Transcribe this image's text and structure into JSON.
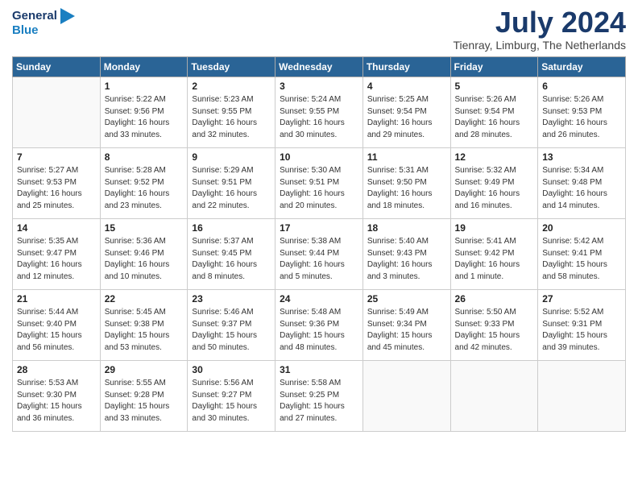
{
  "header": {
    "logo_line1": "General",
    "logo_line2": "Blue",
    "month_title": "July 2024",
    "location": "Tienray, Limburg, The Netherlands"
  },
  "days_of_week": [
    "Sunday",
    "Monday",
    "Tuesday",
    "Wednesday",
    "Thursday",
    "Friday",
    "Saturday"
  ],
  "weeks": [
    [
      {
        "day": "",
        "empty": true
      },
      {
        "day": "1",
        "sunrise": "5:22 AM",
        "sunset": "9:56 PM",
        "daylight": "16 hours and 33 minutes."
      },
      {
        "day": "2",
        "sunrise": "5:23 AM",
        "sunset": "9:55 PM",
        "daylight": "16 hours and 32 minutes."
      },
      {
        "day": "3",
        "sunrise": "5:24 AM",
        "sunset": "9:55 PM",
        "daylight": "16 hours and 30 minutes."
      },
      {
        "day": "4",
        "sunrise": "5:25 AM",
        "sunset": "9:54 PM",
        "daylight": "16 hours and 29 minutes."
      },
      {
        "day": "5",
        "sunrise": "5:26 AM",
        "sunset": "9:54 PM",
        "daylight": "16 hours and 28 minutes."
      },
      {
        "day": "6",
        "sunrise": "5:26 AM",
        "sunset": "9:53 PM",
        "daylight": "16 hours and 26 minutes."
      }
    ],
    [
      {
        "day": "7",
        "sunrise": "5:27 AM",
        "sunset": "9:53 PM",
        "daylight": "16 hours and 25 minutes."
      },
      {
        "day": "8",
        "sunrise": "5:28 AM",
        "sunset": "9:52 PM",
        "daylight": "16 hours and 23 minutes."
      },
      {
        "day": "9",
        "sunrise": "5:29 AM",
        "sunset": "9:51 PM",
        "daylight": "16 hours and 22 minutes."
      },
      {
        "day": "10",
        "sunrise": "5:30 AM",
        "sunset": "9:51 PM",
        "daylight": "16 hours and 20 minutes."
      },
      {
        "day": "11",
        "sunrise": "5:31 AM",
        "sunset": "9:50 PM",
        "daylight": "16 hours and 18 minutes."
      },
      {
        "day": "12",
        "sunrise": "5:32 AM",
        "sunset": "9:49 PM",
        "daylight": "16 hours and 16 minutes."
      },
      {
        "day": "13",
        "sunrise": "5:34 AM",
        "sunset": "9:48 PM",
        "daylight": "16 hours and 14 minutes."
      }
    ],
    [
      {
        "day": "14",
        "sunrise": "5:35 AM",
        "sunset": "9:47 PM",
        "daylight": "16 hours and 12 minutes."
      },
      {
        "day": "15",
        "sunrise": "5:36 AM",
        "sunset": "9:46 PM",
        "daylight": "16 hours and 10 minutes."
      },
      {
        "day": "16",
        "sunrise": "5:37 AM",
        "sunset": "9:45 PM",
        "daylight": "16 hours and 8 minutes."
      },
      {
        "day": "17",
        "sunrise": "5:38 AM",
        "sunset": "9:44 PM",
        "daylight": "16 hours and 5 minutes."
      },
      {
        "day": "18",
        "sunrise": "5:40 AM",
        "sunset": "9:43 PM",
        "daylight": "16 hours and 3 minutes."
      },
      {
        "day": "19",
        "sunrise": "5:41 AM",
        "sunset": "9:42 PM",
        "daylight": "16 hours and 1 minute."
      },
      {
        "day": "20",
        "sunrise": "5:42 AM",
        "sunset": "9:41 PM",
        "daylight": "15 hours and 58 minutes."
      }
    ],
    [
      {
        "day": "21",
        "sunrise": "5:44 AM",
        "sunset": "9:40 PM",
        "daylight": "15 hours and 56 minutes."
      },
      {
        "day": "22",
        "sunrise": "5:45 AM",
        "sunset": "9:38 PM",
        "daylight": "15 hours and 53 minutes."
      },
      {
        "day": "23",
        "sunrise": "5:46 AM",
        "sunset": "9:37 PM",
        "daylight": "15 hours and 50 minutes."
      },
      {
        "day": "24",
        "sunrise": "5:48 AM",
        "sunset": "9:36 PM",
        "daylight": "15 hours and 48 minutes."
      },
      {
        "day": "25",
        "sunrise": "5:49 AM",
        "sunset": "9:34 PM",
        "daylight": "15 hours and 45 minutes."
      },
      {
        "day": "26",
        "sunrise": "5:50 AM",
        "sunset": "9:33 PM",
        "daylight": "15 hours and 42 minutes."
      },
      {
        "day": "27",
        "sunrise": "5:52 AM",
        "sunset": "9:31 PM",
        "daylight": "15 hours and 39 minutes."
      }
    ],
    [
      {
        "day": "28",
        "sunrise": "5:53 AM",
        "sunset": "9:30 PM",
        "daylight": "15 hours and 36 minutes."
      },
      {
        "day": "29",
        "sunrise": "5:55 AM",
        "sunset": "9:28 PM",
        "daylight": "15 hours and 33 minutes."
      },
      {
        "day": "30",
        "sunrise": "5:56 AM",
        "sunset": "9:27 PM",
        "daylight": "15 hours and 30 minutes."
      },
      {
        "day": "31",
        "sunrise": "5:58 AM",
        "sunset": "9:25 PM",
        "daylight": "15 hours and 27 minutes."
      },
      {
        "day": "",
        "empty": true
      },
      {
        "day": "",
        "empty": true
      },
      {
        "day": "",
        "empty": true
      }
    ]
  ]
}
